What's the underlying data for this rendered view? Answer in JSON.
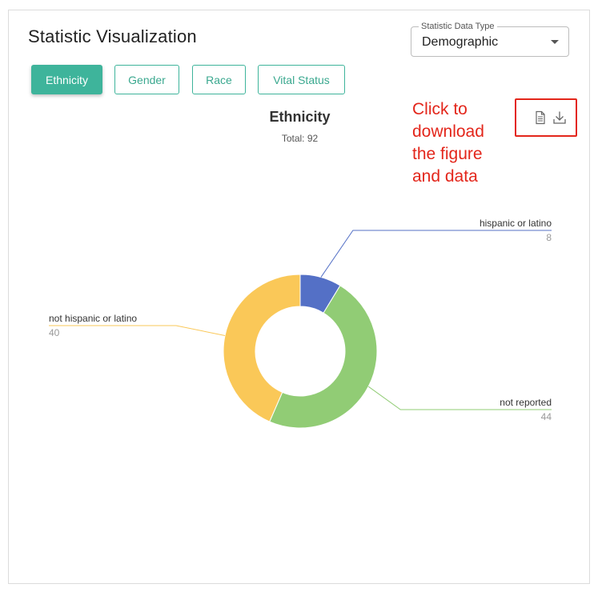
{
  "header": {
    "title": "Statistic Visualization"
  },
  "select": {
    "label": "Statistic Data Type",
    "value": "Demographic"
  },
  "tabs": [
    {
      "label": "Ethnicity",
      "active": true
    },
    {
      "label": "Gender",
      "active": false
    },
    {
      "label": "Race",
      "active": false
    },
    {
      "label": "Vital Status",
      "active": false
    }
  ],
  "annotation": {
    "lines": [
      "Click to",
      "download",
      "the figure",
      "and data"
    ],
    "color": "#e3261b"
  },
  "icons": {
    "data": "document-icon",
    "download": "download-icon"
  },
  "colors": {
    "accent": "#3eb49b"
  },
  "chart_data": {
    "type": "pie",
    "title": "Ethnicity",
    "subtitle": "Total: 92",
    "series": [
      {
        "name": "hispanic or latino",
        "value": 8,
        "color": "#5470c6"
      },
      {
        "name": "not reported",
        "value": 44,
        "color": "#91cc75"
      },
      {
        "name": "not hispanic or latino",
        "value": 40,
        "color": "#fac858"
      }
    ]
  }
}
